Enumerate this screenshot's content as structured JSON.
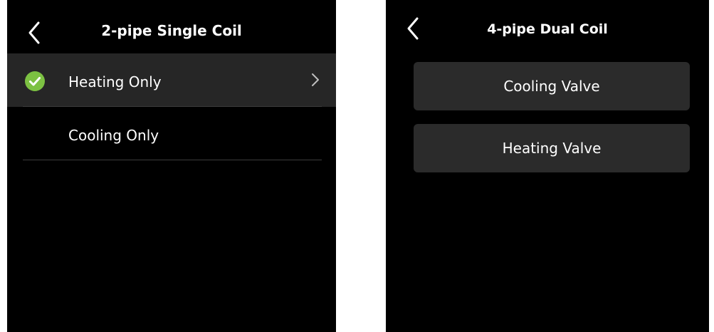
{
  "left_screen": {
    "title": "2-pipe Single Coil",
    "back_icon": "chevron-left-icon",
    "items": [
      {
        "label": "Heating Only",
        "selected": true,
        "icon": "check-circle-icon",
        "trailing_icon": "chevron-right-icon"
      },
      {
        "label": "Cooling Only",
        "selected": false
      }
    ]
  },
  "right_screen": {
    "title": "4-pipe Dual Coil",
    "back_icon": "chevron-left-icon",
    "buttons": [
      {
        "label": "Cooling Valve"
      },
      {
        "label": "Heating Valve"
      }
    ]
  },
  "colors": {
    "background": "#000000",
    "selected_row": "#262626",
    "button_bg": "#2b2b2b",
    "check_green": "#7cc142",
    "divider": "#3c3c3c"
  }
}
